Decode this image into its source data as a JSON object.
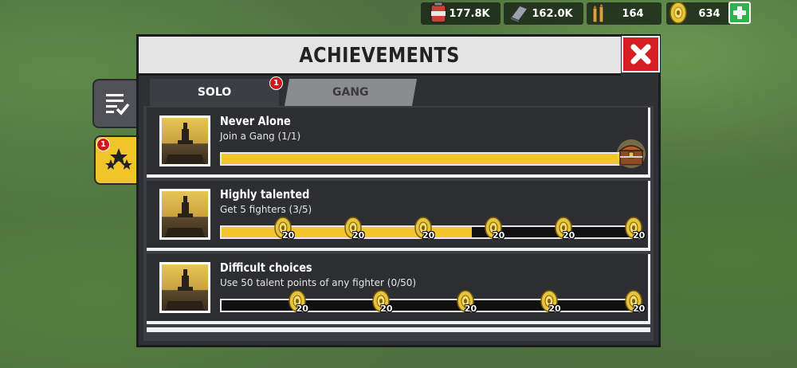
{
  "resources": {
    "fuel": "177.8K",
    "metal": "162.0K",
    "ammo": "164",
    "gold": "634"
  },
  "side_tabs": {
    "achievements_badge": "1"
  },
  "window": {
    "title": "ACHIEVEMENTS",
    "tabs": [
      {
        "label": "SOLO",
        "badge": "1"
      },
      {
        "label": "GANG"
      }
    ]
  },
  "achievements": [
    {
      "title": "Never Alone",
      "description": "Join a Gang (1/1)",
      "progress": 1.0,
      "reward": "chest"
    },
    {
      "title": "Highly talented",
      "description": "Get 5 fighters (3/5)",
      "progress": 0.6,
      "reward_labels": [
        "20",
        "20",
        "20",
        "20",
        "20",
        "20"
      ]
    },
    {
      "title": "Difficult choices",
      "description": "Use 50 talent points of any fighter (0/50)",
      "progress": 0.0,
      "reward_labels": [
        "20",
        "20",
        "20",
        "20",
        "20"
      ]
    }
  ],
  "colors": {
    "progress_fill": "#f2c52b",
    "close_button": "#d51f22",
    "add_button": "#2fb34a",
    "badge": "#d0161b"
  }
}
